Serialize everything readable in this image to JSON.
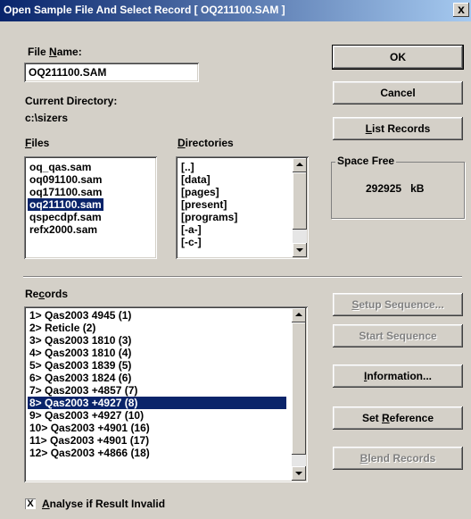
{
  "window": {
    "title": "Open Sample File And Select Record [ OQ211100.SAM ]",
    "close_glyph": "x"
  },
  "file_name": {
    "label_pre": "File ",
    "label_mnemonic": "N",
    "label_post": "ame:",
    "value": "OQ211100.SAM"
  },
  "current_directory": {
    "label": "Current Directory:",
    "value": "c:\\sizers"
  },
  "files": {
    "label_mnemonic": "F",
    "label_post": "iles",
    "items": [
      "oq_qas.sam",
      "oq091100.sam",
      "oq171100.sam",
      "oq211100.sam",
      "qspecdpf.sam",
      "refx2000.sam"
    ],
    "selected_index": 3
  },
  "directories": {
    "label_mnemonic": "D",
    "label_post": "irectories",
    "items": [
      "[..]",
      "[data]",
      "[pages]",
      "[present]",
      "[programs]",
      "[-a-]",
      "[-c-]"
    ]
  },
  "buttons": {
    "ok": "OK",
    "cancel": "Cancel",
    "list_records": {
      "mnemonic": "L",
      "post": "ist Records"
    },
    "setup_sequence": {
      "mnemonic": "S",
      "post": "etup Sequence..."
    },
    "start_sequence": "Start Sequence",
    "information": {
      "mnemonic": "I",
      "post": "nformation..."
    },
    "set_reference": {
      "pre": "Set ",
      "mnemonic": "R",
      "post": "eference"
    },
    "blend_records": {
      "mnemonic": "B",
      "post": "lend Records"
    }
  },
  "space_free": {
    "label": "Space Free",
    "value": "292925",
    "unit": "kB"
  },
  "records": {
    "label_pre": "Re",
    "label_mnemonic": "c",
    "label_post": "ords",
    "items": [
      "1> Qas2003 4945 (1)",
      "2> Reticle (2)",
      "3> Qas2003 1810 (3)",
      "4> Qas2003 1810 (4)",
      "5> Qas2003 1839 (5)",
      "6> Qas2003 1824 (6)",
      "7> Qas2003  +4857 (7)",
      "8> Qas2003  +4927 (8)",
      "9> Qas2003  +4927 (10)",
      "10> Qas2003  +4901 (16)",
      "11> Qas2003  +4901 (17)",
      "12> Qas2003  +4866 (18)"
    ],
    "selected_index": 7
  },
  "analyse": {
    "checked": true,
    "check_glyph": "X",
    "label_mnemonic": "A",
    "label_post": "nalyse if Result Invalid"
  },
  "colors": {
    "selection": "#0a246a",
    "face": "#d4d0c8",
    "title_start": "#08246b",
    "title_end": "#a6caf0"
  }
}
